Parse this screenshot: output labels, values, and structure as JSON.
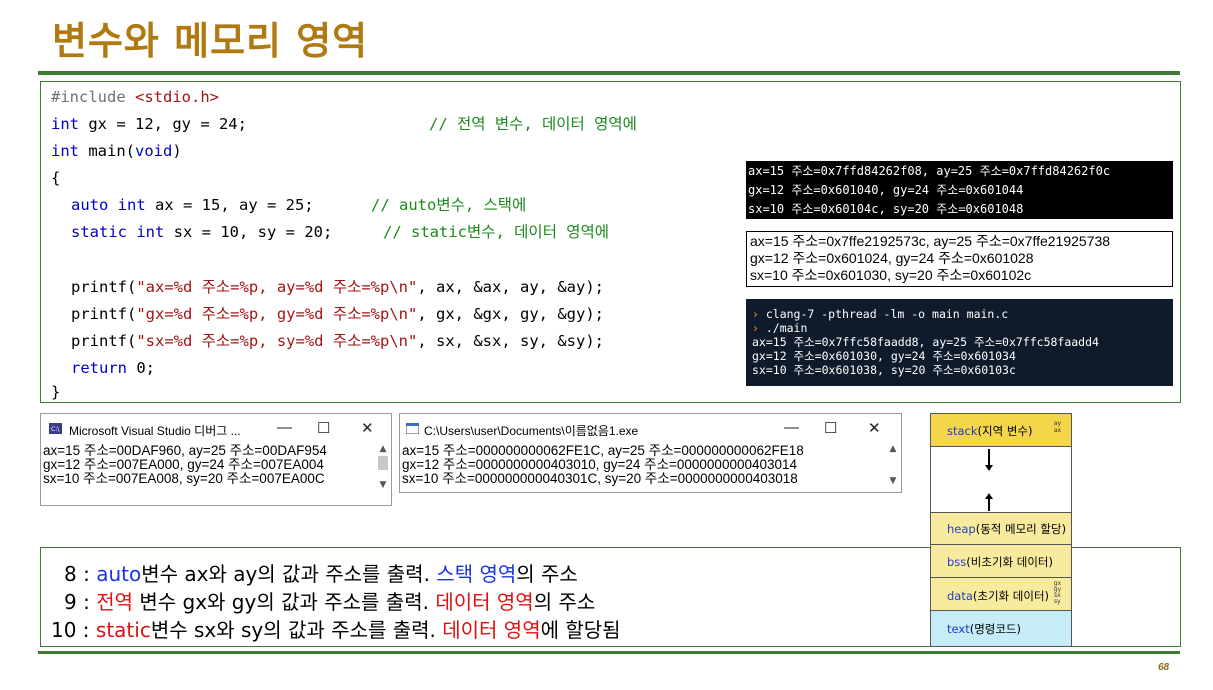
{
  "slide": {
    "title": "변수와 메모리 영역",
    "page_number": "68"
  },
  "code": {
    "l1a": "#include ",
    "l1b": "<stdio.h>",
    "l2a": "int",
    "l2b": " gx = 12, gy = 24;",
    "l2c": "// 전역 변수, 데이터 영역에",
    "l3a": "int",
    "l3b": " main(",
    "l3c": "void",
    "l3d": ")",
    "l4": "{",
    "l5a": "auto",
    "l5b": "int",
    "l5c": " ax = 15, ay = 25;",
    "l5d": "// auto변수, 스택에",
    "l6a": "static",
    "l6b": "int",
    "l6c": " sx = 10, sy = 20;",
    "l6d": "// static변수, 데이터 영역에",
    "l8a": "printf(",
    "l8b": "\"ax=%d 주소=%p, ay=%d 주소=%p\\n\"",
    "l8c": ", ax, &ax, ay, &ay);",
    "l9a": "printf(",
    "l9b": "\"gx=%d 주소=%p, gy=%d 주소=%p\\n\"",
    "l9c": ", gx, &gx, gy, &gy);",
    "l10a": "printf(",
    "l10b": "\"sx=%d 주소=%p, sy=%d 주소=%p\\n\"",
    "l10c": ", sx, &sx, sy, &sy);",
    "l11a": "return",
    "l11b": " 0;",
    "l12": "}"
  },
  "terminal_linux": {
    "line1": "ax=15 주소=0x7ffd84262f08, ay=25 주소=0x7ffd84262f0c",
    "line2": "gx=12 주소=0x601040, gy=24 주소=0x601044",
    "line3": "sx=10 주소=0x60104c, sy=20 주소=0x601048"
  },
  "terminal_white": {
    "line1": "ax=15 주소=0x7ffe2192573c, ay=25 주소=0x7ffe21925738",
    "line2": "gx=12 주소=0x601024, gy=24 주소=0x601028",
    "line3": "sx=10 주소=0x601030, sy=20 주소=0x60102c"
  },
  "terminal_repl": {
    "prompt": "›",
    "cmd1": " clang-7 -pthread -lm -o main main.c",
    "cmd2": " ./main",
    "line1": "ax=15 주소=0x7ffc58faadd8, ay=25 주소=0x7ffc58faadd4",
    "line2": "gx=12 주소=0x601030, gy=24 주소=0x601034",
    "line3": "sx=10 주소=0x601038, sy=20 주소=0x60103c"
  },
  "window_vs": {
    "title": "Microsoft Visual Studio 디버그 ...",
    "minimize": "—",
    "maximize": "☐",
    "close": "✕",
    "line1": "ax=15 주소=00DAF960, ay=25 주소=00DAF954",
    "line2": "gx=12 주소=007EA000, gy=24 주소=007EA004",
    "line3": "sx=10 주소=007EA008, sy=20 주소=007EA00C"
  },
  "window_exe": {
    "title": "C:\\Users\\user\\Documents\\이름없음1.exe",
    "minimize": "—",
    "maximize": "☐",
    "close": "✕",
    "line1": "ax=15 주소=000000000062FE1C, ay=25 주소=000000000062FE18",
    "line2": "gx=12 주소=0000000000403010, gy=24 주소=0000000000403014",
    "line3": "sx=10 주소=000000000040301C, sy=20 주소=0000000000403018"
  },
  "memory": {
    "stack_en": "stack",
    "stack_ko": "(지역 변수)",
    "stack_vars_1": "ay",
    "stack_vars_2": "ax",
    "heap_en": "heap",
    "heap_ko": "(동적 메모리 할당)",
    "bss_en": "bss",
    "bss_ko": "(비초기화 데이터)",
    "data_en": "data",
    "data_ko": "(초기화 데이터)",
    "data_vars_1": "gx",
    "data_vars_2": "gy",
    "data_vars_3": "sx",
    "data_vars_4": "sy",
    "text_en": "text",
    "text_ko": "(명령코드)",
    "colors": {
      "stack": "#f5d54a",
      "heap": "#f9eb9e",
      "bss": "#f9eb9e",
      "data": "#f9eb9e",
      "text": "#c6ecf8"
    }
  },
  "explanation": {
    "r1_num": "8 : ",
    "r1_a": "auto",
    "r1_b": "변수 ax와 ay의 값과 주소를 출력. ",
    "r1_c": "스택 영역",
    "r1_d": "의 주소",
    "r2_num": "9 : ",
    "r2_a": "전역",
    "r2_b": " 변수 gx와 gy의 값과 주소를 출력. ",
    "r2_c": "데이터 영역",
    "r2_d": "의 주소",
    "r3_num": "10 : ",
    "r3_a": "static",
    "r3_b": "변수 sx와 sy의 값과 주소를 출력.  ",
    "r3_c": "데이터 영역",
    "r3_d": "에 할당됨"
  }
}
